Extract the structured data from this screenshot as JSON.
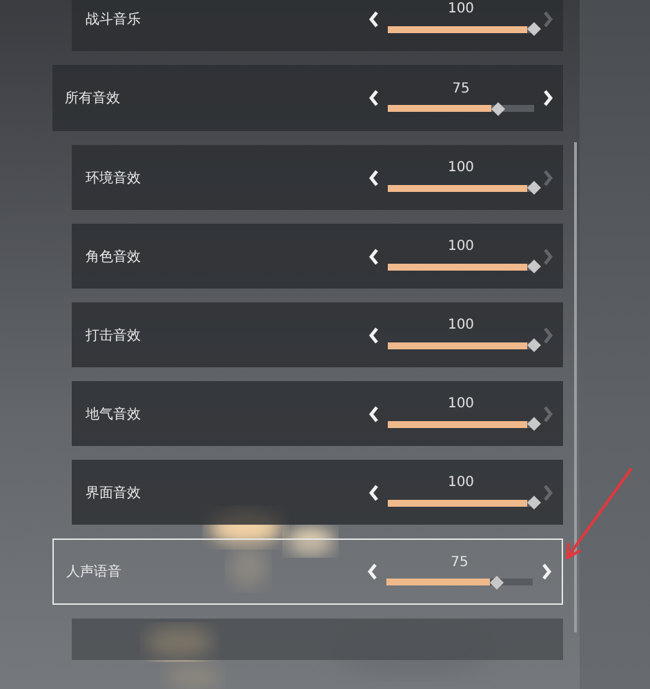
{
  "rows": [
    {
      "kind": "sub",
      "label": "战斗音乐",
      "value": "100",
      "level": 1,
      "next_disabled": true,
      "selected": false
    },
    {
      "kind": "category",
      "label": "所有音效",
      "value": "75",
      "level": 0.75,
      "next_disabled": false,
      "selected": false
    },
    {
      "kind": "sub",
      "label": "环境音效",
      "value": "100",
      "level": 1,
      "next_disabled": true,
      "selected": false
    },
    {
      "kind": "sub",
      "label": "角色音效",
      "value": "100",
      "level": 1,
      "next_disabled": true,
      "selected": false
    },
    {
      "kind": "sub",
      "label": "打击音效",
      "value": "100",
      "level": 1,
      "next_disabled": true,
      "selected": false
    },
    {
      "kind": "sub",
      "label": "地气音效",
      "value": "100",
      "level": 1,
      "next_disabled": true,
      "selected": false
    },
    {
      "kind": "sub",
      "label": "界面音效",
      "value": "100",
      "level": 1,
      "next_disabled": true,
      "selected": false
    },
    {
      "kind": "category",
      "label": "人声语音",
      "value": "75",
      "level": 0.75,
      "next_disabled": false,
      "selected": true
    }
  ]
}
